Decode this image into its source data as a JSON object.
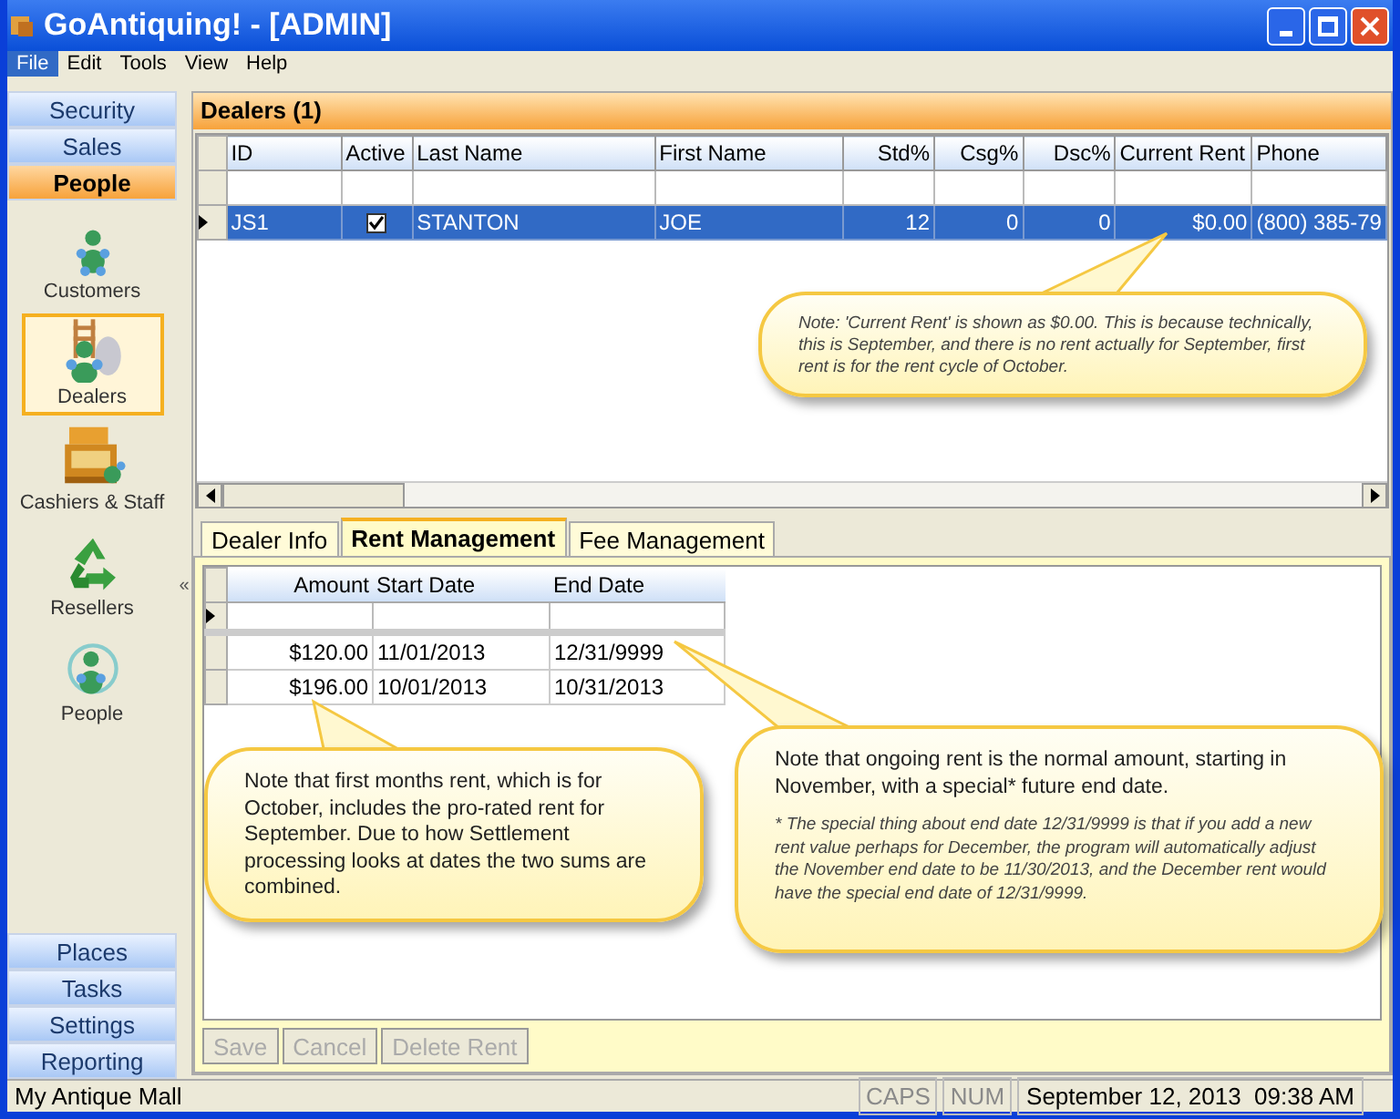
{
  "window": {
    "title": "GoAntiquing! - [ADMIN]"
  },
  "menu": [
    {
      "label": "File",
      "selected": true
    },
    {
      "label": "Edit",
      "selected": false
    },
    {
      "label": "Tools",
      "selected": false
    },
    {
      "label": "View",
      "selected": false
    },
    {
      "label": "Help",
      "selected": false
    }
  ],
  "sidebar": {
    "top_groups": [
      {
        "label": "Security",
        "selected": false
      },
      {
        "label": "Sales",
        "selected": false
      },
      {
        "label": "People",
        "selected": true
      }
    ],
    "items": [
      {
        "label": "Customers",
        "kind": "customers",
        "selected": false
      },
      {
        "label": "Dealers",
        "kind": "dealers",
        "selected": true
      },
      {
        "label": "Cashiers & Staff",
        "kind": "cashiers",
        "selected": false
      },
      {
        "label": "Resellers",
        "kind": "resellers",
        "selected": false
      },
      {
        "label": "People",
        "kind": "people",
        "selected": false
      }
    ],
    "bottom_groups": [
      {
        "label": "Places",
        "selected": false
      },
      {
        "label": "Tasks",
        "selected": false
      },
      {
        "label": "Settings",
        "selected": false
      },
      {
        "label": "Reporting",
        "selected": false
      }
    ],
    "collapse": "«"
  },
  "panel": {
    "title": "Dealers (1)"
  },
  "table": {
    "columns": [
      "ID",
      "Active",
      "Last Name",
      "First Name",
      "Std%",
      "Csg%",
      "Dsc%",
      "Current Rent",
      "Phone"
    ],
    "rows": [
      {
        "selected": true,
        "id": "JS1",
        "active": true,
        "last_name": "STANTON",
        "first_name": "JOE",
        "std": "12",
        "csg": "0",
        "dsc": "0",
        "current_rent": "$0.00",
        "phone": "(800) 385-79"
      }
    ]
  },
  "tabs": [
    {
      "label": "Dealer Info",
      "selected": false
    },
    {
      "label": "Rent Management",
      "selected": true
    },
    {
      "label": "Fee Management",
      "selected": false
    }
  ],
  "rent_table": {
    "columns": [
      "Amount",
      "Start Date",
      "End Date"
    ],
    "rows": [
      {
        "amount": "$120.00",
        "start": "11/01/2013",
        "end": "12/31/9999"
      },
      {
        "amount": "$196.00",
        "start": "10/01/2013",
        "end": "10/31/2013"
      }
    ]
  },
  "buttons": [
    {
      "label": "Save",
      "disabled": true
    },
    {
      "label": "Cancel",
      "disabled": true
    },
    {
      "label": "Delete Rent",
      "disabled": true
    }
  ],
  "notes": [
    {
      "text": "Note: 'Current Rent' is shown as $0.00.  This is because technically, this is September, and there is no rent actually for September, first rent is for the rent cycle of October."
    },
    {
      "text": "Note that first months rent, which is for October, includes the pro-rated rent for September.  Due to how Settlement processing looks at dates the two sums are combined."
    },
    {
      "text": "Note that ongoing rent is the normal amount, starting in November, with a special* future end date.",
      "footnote": "* The special thing about end date 12/31/9999 is that if you add a new rent value perhaps for December, the program will automatically adjust the November end date to be 11/30/2013, and the December rent would have the special end date of 12/31/9999."
    }
  ],
  "status_bar": {
    "location": "My Antique Mall",
    "caps": {
      "label": "CAPS",
      "disabled": true
    },
    "num": {
      "label": "NUM",
      "disabled": true
    },
    "datetime": "September 12, 2013  09:38 AM"
  }
}
